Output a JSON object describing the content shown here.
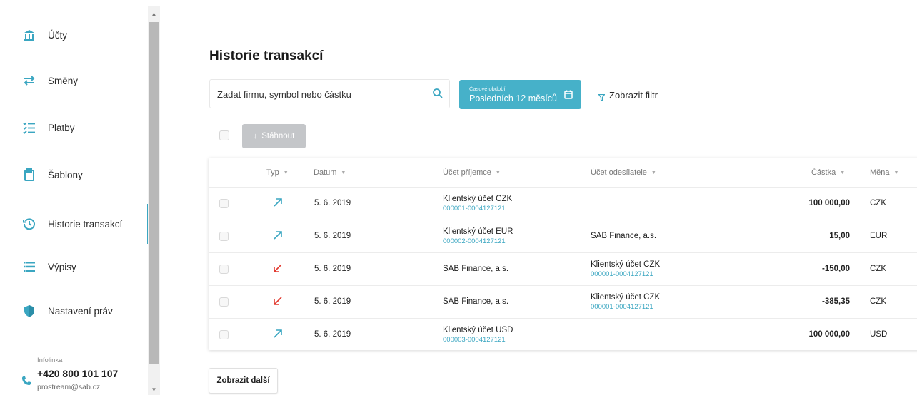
{
  "sidebar": {
    "items": [
      {
        "label": "Účty",
        "icon": "bank-icon"
      },
      {
        "label": "Směny",
        "icon": "exchange-icon"
      },
      {
        "label": "Platby",
        "icon": "checklist-icon"
      },
      {
        "label": "Šablony",
        "icon": "clipboard-icon"
      },
      {
        "label": "Historie transakcí",
        "icon": "history-icon"
      },
      {
        "label": "Výpisy",
        "icon": "list-icon"
      },
      {
        "label": "Nastavení práv",
        "icon": "shield-icon"
      }
    ],
    "infoline": {
      "title": "Infolinka",
      "phone": "+420 800 101 107",
      "email": "prostream@sab.cz"
    }
  },
  "main": {
    "title": "Historie transakcí",
    "search": {
      "placeholder": "Zadat firmu, symbol nebo částku"
    },
    "period": {
      "label": "Časové období",
      "value": "Posledních 12 měsíců"
    },
    "filter_label": "Zobrazit filtr",
    "download_label": "Stáhnout",
    "more_label": "Zobrazit další"
  },
  "table": {
    "columns": {
      "type": "Typ",
      "date": "Datum",
      "recipient": "Účet příjemce",
      "sender": "Účet odesílatele",
      "amount": "Částka",
      "currency": "Měna"
    },
    "rows": [
      {
        "direction": "incoming",
        "date": "5. 6. 2019",
        "recipient": "Klientský účet CZK",
        "recipient_no": "000001-0004127121",
        "sender": "",
        "sender_no": "",
        "amount": "100 000,00",
        "currency": "CZK"
      },
      {
        "direction": "incoming",
        "date": "5. 6. 2019",
        "recipient": "Klientský účet EUR",
        "recipient_no": "000002-0004127121",
        "sender": "SAB Finance, a.s.",
        "sender_no": "",
        "amount": "15,00",
        "currency": "EUR"
      },
      {
        "direction": "outgoing",
        "date": "5. 6. 2019",
        "recipient": "SAB Finance, a.s.",
        "recipient_no": "",
        "sender": "Klientský účet CZK",
        "sender_no": "000001-0004127121",
        "amount": "-150,00",
        "currency": "CZK"
      },
      {
        "direction": "outgoing",
        "date": "5. 6. 2019",
        "recipient": "SAB Finance, a.s.",
        "recipient_no": "",
        "sender": "Klientský účet CZK",
        "sender_no": "000001-0004127121",
        "amount": "-385,35",
        "currency": "CZK"
      },
      {
        "direction": "incoming",
        "date": "5. 6. 2019",
        "recipient": "Klientský účet USD",
        "recipient_no": "000003-0004127121",
        "sender": "",
        "sender_no": "",
        "amount": "100 000,00",
        "currency": "USD"
      }
    ]
  },
  "colors": {
    "accent": "#46b1c9",
    "incoming": "#3aa6c1",
    "outgoing": "#e2392f",
    "icon": "#3aa6c1"
  }
}
